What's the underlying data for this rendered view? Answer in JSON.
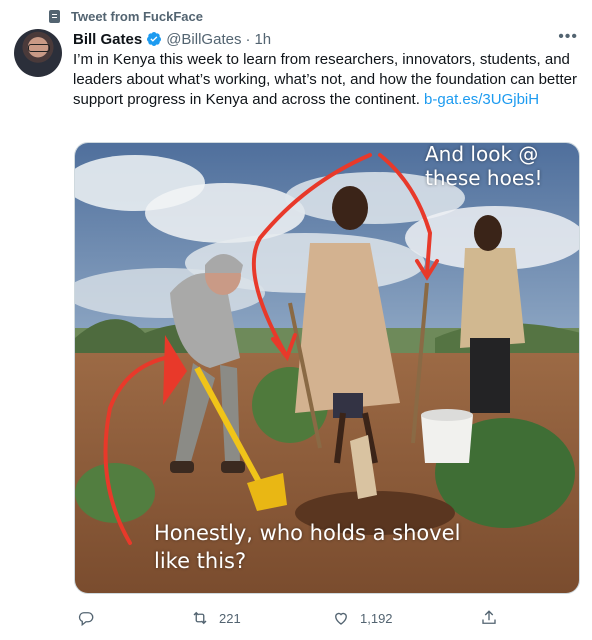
{
  "context": {
    "label": "Tweet from FuckFace"
  },
  "author": {
    "name": "Bill Gates",
    "handle": "@BillGates",
    "separator": "·",
    "time": "1h"
  },
  "tweet": {
    "text": "I’m in Kenya this week to learn from researchers, innovators, students, and leaders about what’s working, what’s not, and how the foundation can better support progress in Kenya and across the continent.",
    "link": "b-gat.es/3UGjbiH"
  },
  "media": {
    "caption_top": "And look @ these hoes!",
    "caption_bottom": "Honestly, who holds a shovel like this?"
  },
  "actions": {
    "reply_count": "",
    "retweet_count": "221",
    "like_count": "1,192"
  },
  "colors": {
    "link": "#1d9bf0",
    "secondary_text": "#536471",
    "annotation_red": "#e8392a"
  },
  "icons": [
    "document-icon",
    "verified-badge-icon",
    "more-icon",
    "reply-icon",
    "retweet-icon",
    "like-icon",
    "share-icon"
  ]
}
